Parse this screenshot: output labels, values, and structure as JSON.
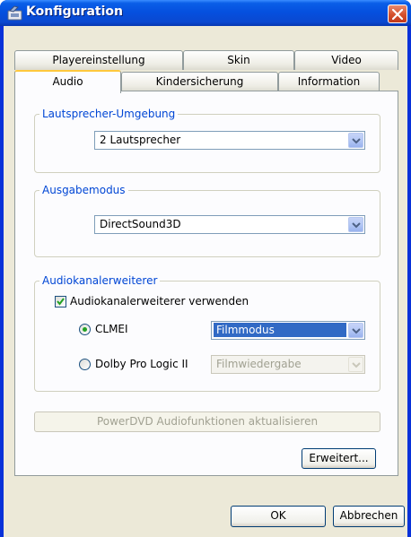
{
  "window": {
    "title": "Konfiguration"
  },
  "tabs": {
    "row1": [
      "Playereinstellung",
      "Skin",
      "Video"
    ],
    "row2": [
      "Audio",
      "Kindersicherung",
      "Information"
    ],
    "active": "Audio"
  },
  "speaker": {
    "legend": "Lautsprecher-Umgebung",
    "value": "2 Lautsprecher"
  },
  "output": {
    "legend": "Ausgabemodus",
    "value": "DirectSound3D"
  },
  "expander": {
    "legend": "Audiokanalerweiterer",
    "enable_label": "Audiokanalerweiterer verwenden",
    "enable_checked": true,
    "clmei_label": "CLMEI",
    "clmei_value": "Filmmodus",
    "dolby_label": "Dolby Pro Logic II",
    "dolby_value": "Filmwiedergabe"
  },
  "buttons": {
    "update": "PowerDVD Audiofunktionen aktualisieren",
    "advanced": "Erweitert...",
    "ok": "OK",
    "cancel": "Abbrechen"
  },
  "colors": {
    "title_bar": "#0550df",
    "legend_text": "#0046d5",
    "selection": "#316ac5",
    "radio_dot": "#21a121"
  },
  "icons": [
    "app-icon",
    "close-icon",
    "chevron-down-icon",
    "checkmark-icon"
  ]
}
